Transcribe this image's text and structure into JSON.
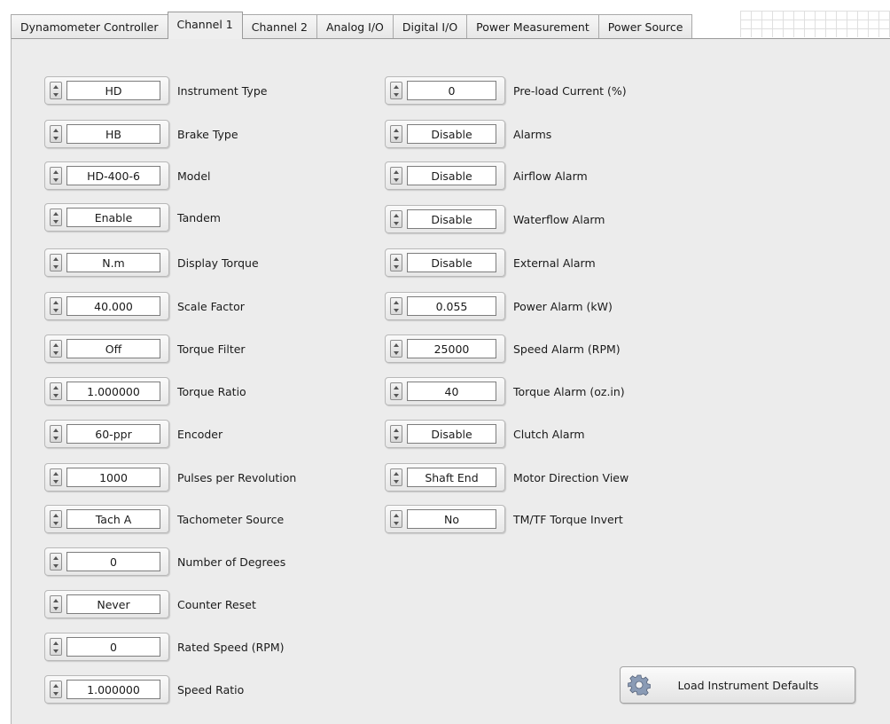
{
  "tabs": [
    {
      "label": "Dynamometer Controller",
      "active": false
    },
    {
      "label": "Channel 1",
      "active": true
    },
    {
      "label": "Channel 2",
      "active": false
    },
    {
      "label": "Analog I/O",
      "active": false
    },
    {
      "label": "Digital I/O",
      "active": false
    },
    {
      "label": "Power Measurement",
      "active": false
    },
    {
      "label": "Power Source",
      "active": false
    }
  ],
  "left_controls": [
    {
      "value": "HD",
      "label": "Instrument Type"
    },
    {
      "value": "HB",
      "label": "Brake Type"
    },
    {
      "value": "HD-400-6",
      "label": "Model"
    },
    {
      "value": "Enable",
      "label": "Tandem"
    },
    {
      "value": "N.m",
      "label": "Display Torque"
    },
    {
      "value": "40.000",
      "label": "Scale Factor"
    },
    {
      "value": "Off",
      "label": "Torque Filter"
    },
    {
      "value": "1.000000",
      "label": "Torque Ratio"
    },
    {
      "value": "60-ppr",
      "label": "Encoder"
    },
    {
      "value": "1000",
      "label": "Pulses per Revolution"
    },
    {
      "value": "Tach A",
      "label": "Tachometer Source"
    },
    {
      "value": "0",
      "label": "Number of Degrees"
    },
    {
      "value": "Never",
      "label": "Counter Reset"
    },
    {
      "value": "0",
      "label": "Rated Speed (RPM)"
    },
    {
      "value": "1.000000",
      "label": "Speed Ratio"
    }
  ],
  "right_controls": [
    {
      "value": "0",
      "label": "Pre-load Current (%)"
    },
    {
      "value": "Disable",
      "label": "Alarms"
    },
    {
      "value": "Disable",
      "label": "Airflow Alarm"
    },
    {
      "value": "Disable",
      "label": "Waterflow Alarm"
    },
    {
      "value": "Disable",
      "label": "External Alarm"
    },
    {
      "value": "0.055",
      "label": "Power Alarm (kW)"
    },
    {
      "value": "25000",
      "label": "Speed Alarm (RPM)"
    },
    {
      "value": "40",
      "label": "Torque Alarm (oz.in)"
    },
    {
      "value": "Disable",
      "label": "Clutch Alarm"
    },
    {
      "value": "Shaft End",
      "label": "Motor Direction View"
    },
    {
      "value": "No",
      "label": "TM/TF Torque Invert"
    }
  ],
  "load_defaults_button": {
    "label": "Load Instrument Defaults",
    "icon": "gear-icon"
  }
}
